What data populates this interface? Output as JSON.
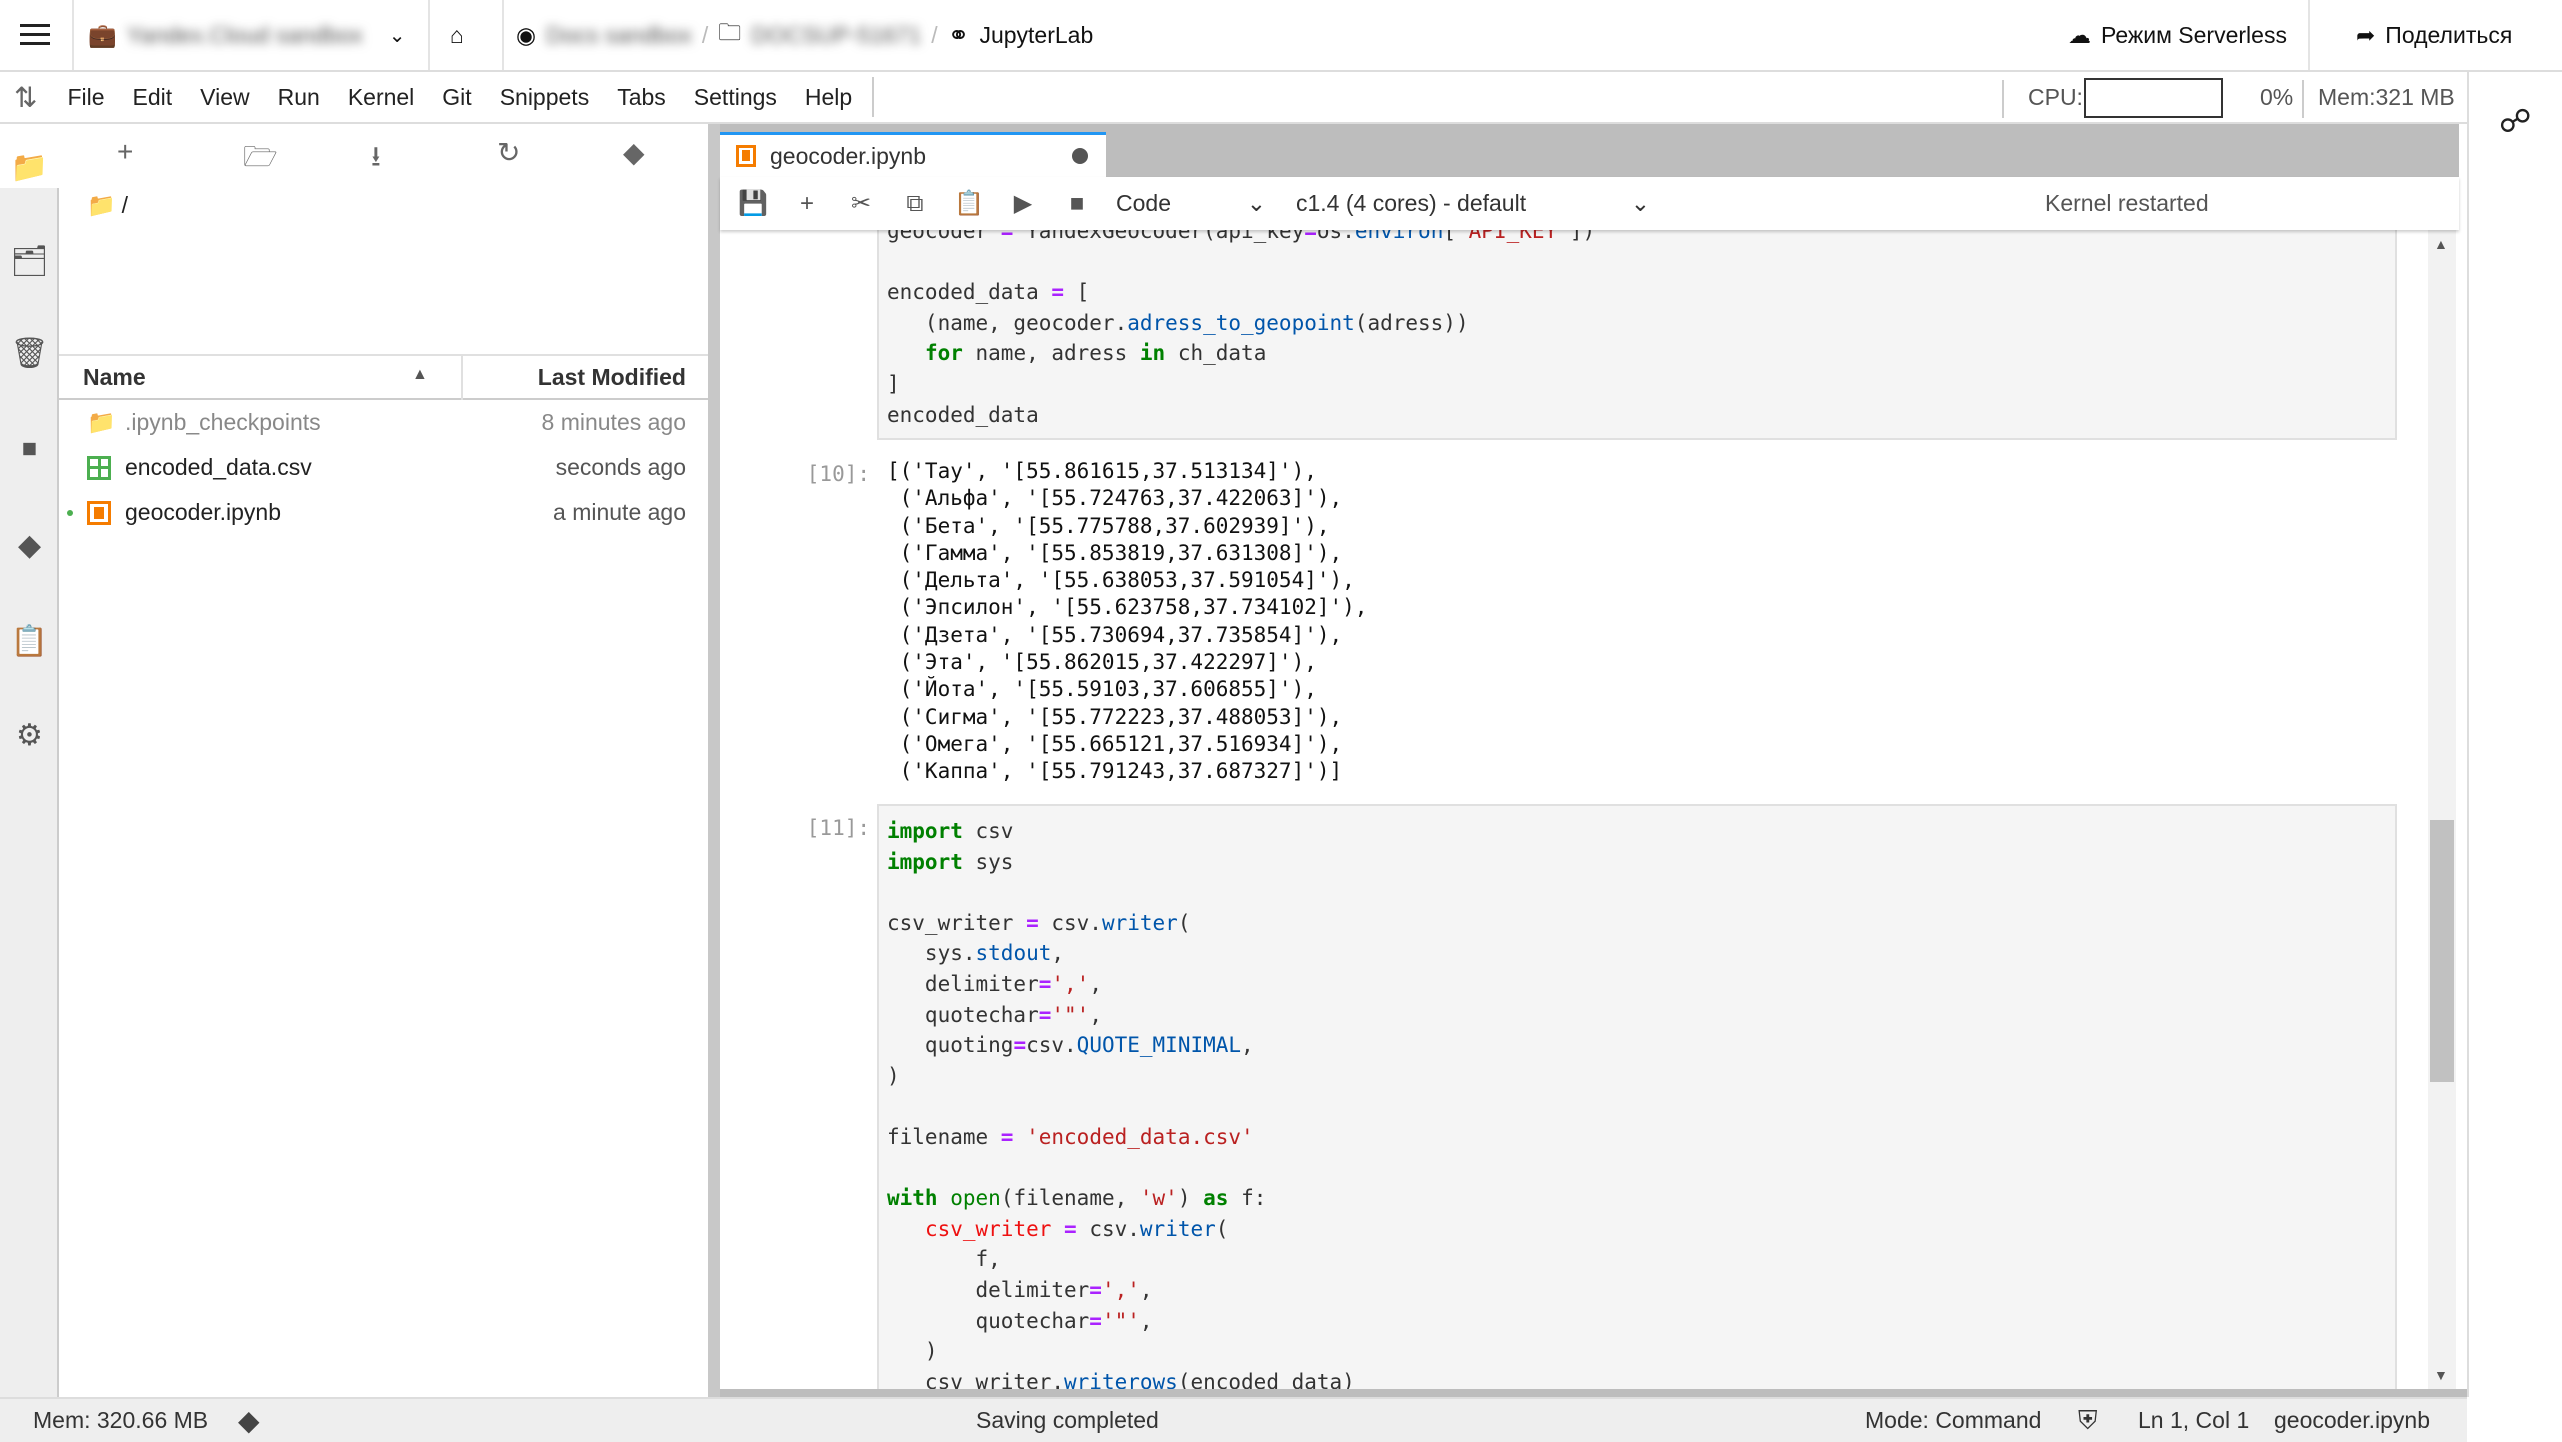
{
  "topbar": {
    "cloud_name": "Yandex.Cloud sandbox",
    "project": "Docs sandbox",
    "folder": "DOCSUP-51671",
    "app": "JupyterLab",
    "serverless": "Режим Serverless",
    "share": "Поделиться"
  },
  "menu": [
    "File",
    "Edit",
    "View",
    "Run",
    "Kernel",
    "Git",
    "Snippets",
    "Tabs",
    "Settings",
    "Help"
  ],
  "resources": {
    "cpu_label": "CPU:",
    "cpu_value": "0%",
    "cpu_percent": 0,
    "mem": "Mem:321 MB"
  },
  "browser": {
    "path": "/",
    "col_name": "Name",
    "col_modified": "Last Modified",
    "files": [
      {
        "name": ".ipynb_checkpoints",
        "modified": "8 minutes ago",
        "icon": "folder-icon"
      },
      {
        "name": "encoded_data.csv",
        "modified": "seconds ago",
        "icon": "spreadsheet-icon"
      },
      {
        "name": "geocoder.ipynb",
        "modified": "a minute ago",
        "icon": "notebook-icon",
        "running": true
      }
    ]
  },
  "tab": {
    "title": "geocoder.ipynb"
  },
  "toolbar": {
    "cell_type": "Code",
    "kernel": "c1.4 (4 cores) - default",
    "kernel_status": "Kernel restarted"
  },
  "cells": [
    {
      "prompt": "",
      "lines": [
        [
          [
            "geocoder ",
            "n"
          ],
          [
            "=",
            "o"
          ],
          [
            " YandexGeocoder(api_key",
            "n"
          ],
          [
            "=",
            "o"
          ],
          [
            "os.",
            "n"
          ],
          [
            "environ",
            "p"
          ],
          [
            "[",
            "n"
          ],
          [
            "'API_KEY'",
            "s"
          ],
          [
            "])",
            "n"
          ]
        ],
        [],
        [
          [
            "encoded_data ",
            "n"
          ],
          [
            "=",
            "o"
          ],
          [
            " [",
            "n"
          ]
        ],
        [
          [
            "   (name, geocoder.",
            "n"
          ],
          [
            "adress_to_geopoint",
            "p"
          ],
          [
            "(adress))",
            "n"
          ]
        ],
        [
          [
            "   ",
            "n"
          ],
          [
            "for",
            "k"
          ],
          [
            " name, adress ",
            "n"
          ],
          [
            "in",
            "k"
          ],
          [
            " ch_data",
            "n"
          ]
        ],
        [
          [
            "]",
            "n"
          ]
        ],
        [
          [
            "encoded_data",
            "n"
          ]
        ]
      ]
    },
    {
      "prompt": "[10]:",
      "output": [
        "[('Тау', '[55.861615,37.513134]'),",
        " ('Альфа', '[55.724763,37.422063]'),",
        " ('Бета', '[55.775788,37.602939]'),",
        " ('Гамма', '[55.853819,37.631308]'),",
        " ('Дельта', '[55.638053,37.591054]'),",
        " ('Эпсилон', '[55.623758,37.734102]'),",
        " ('Дзета', '[55.730694,37.735854]'),",
        " ('Эта', '[55.862015,37.422297]'),",
        " ('Йота', '[55.59103,37.606855]'),",
        " ('Сигма', '[55.772223,37.488053]'),",
        " ('Омега', '[55.665121,37.516934]'),",
        " ('Каппа', '[55.791243,37.687327]')]"
      ]
    },
    {
      "prompt": "[11]:",
      "lines": [
        [
          [
            "import",
            "k"
          ],
          [
            " csv",
            "n"
          ]
        ],
        [
          [
            "import",
            "k"
          ],
          [
            " sys",
            "n"
          ]
        ],
        [],
        [
          [
            "csv_writer ",
            "n"
          ],
          [
            "=",
            "o"
          ],
          [
            " csv.",
            "n"
          ],
          [
            "writer",
            "p"
          ],
          [
            "(",
            "n"
          ]
        ],
        [
          [
            "   sys.",
            "n"
          ],
          [
            "stdout",
            "p"
          ],
          [
            ",",
            "n"
          ]
        ],
        [
          [
            "   delimiter",
            "n"
          ],
          [
            "=",
            "o"
          ],
          [
            "','",
            "s"
          ],
          [
            ",",
            "n"
          ]
        ],
        [
          [
            "   quotechar",
            "n"
          ],
          [
            "=",
            "o"
          ],
          [
            "'\"'",
            "s"
          ],
          [
            ",",
            "n"
          ]
        ],
        [
          [
            "   quoting",
            "n"
          ],
          [
            "=",
            "o"
          ],
          [
            "csv.",
            "n"
          ],
          [
            "QUOTE_MINIMAL",
            "p"
          ],
          [
            ",",
            "n"
          ]
        ],
        [
          [
            ")",
            "n"
          ]
        ],
        [],
        [
          [
            "filename ",
            "n"
          ],
          [
            "=",
            "o"
          ],
          [
            " ",
            "n"
          ],
          [
            "'encoded_data.csv'",
            "s"
          ]
        ],
        [],
        [
          [
            "with",
            "k"
          ],
          [
            " ",
            "n"
          ],
          [
            "open",
            "b"
          ],
          [
            "(filename, ",
            "n"
          ],
          [
            "'w'",
            "s"
          ],
          [
            ") ",
            "n"
          ],
          [
            "as",
            "k"
          ],
          [
            " f:",
            "n"
          ]
        ],
        [
          [
            "   ",
            "n"
          ],
          [
            "csv_writer",
            "v"
          ],
          [
            " ",
            "n"
          ],
          [
            "=",
            "o"
          ],
          [
            " csv.",
            "n"
          ],
          [
            "writer",
            "p"
          ],
          [
            "(",
            "n"
          ]
        ],
        [
          [
            "       f,",
            "n"
          ]
        ],
        [
          [
            "       delimiter",
            "n"
          ],
          [
            "=",
            "o"
          ],
          [
            "','",
            "s"
          ],
          [
            ",",
            "n"
          ]
        ],
        [
          [
            "       quotechar",
            "n"
          ],
          [
            "=",
            "o"
          ],
          [
            "'\"'",
            "s"
          ],
          [
            ",",
            "n"
          ]
        ],
        [
          [
            "   )",
            "n"
          ]
        ],
        [
          [
            "   csv_writer.",
            "n"
          ],
          [
            "writerows",
            "p"
          ],
          [
            "(encoded_data)",
            "n"
          ]
        ]
      ]
    }
  ],
  "status": {
    "mem": "Mem: 320.66 MB",
    "message": "Saving completed",
    "mode": "Mode: Command",
    "position": "Ln 1, Col 1",
    "file": "geocoder.ipynb"
  },
  "colors": {
    "accent": "#2196f3",
    "notebook": "#f57c00",
    "csv": "#4caf50"
  }
}
